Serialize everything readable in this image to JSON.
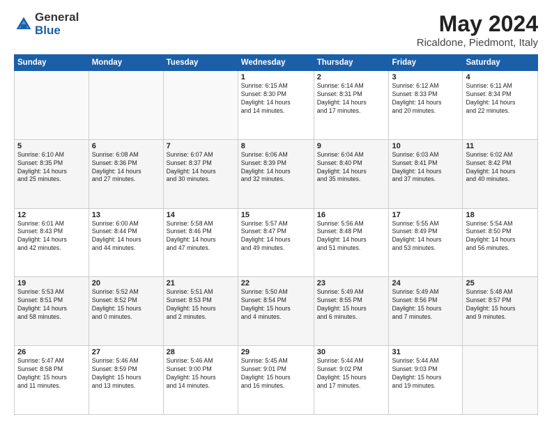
{
  "header": {
    "logo_general": "General",
    "logo_blue": "Blue",
    "title": "May 2024",
    "location": "Ricaldone, Piedmont, Italy"
  },
  "days_of_week": [
    "Sunday",
    "Monday",
    "Tuesday",
    "Wednesday",
    "Thursday",
    "Friday",
    "Saturday"
  ],
  "weeks": [
    [
      {
        "day": "",
        "content": ""
      },
      {
        "day": "",
        "content": ""
      },
      {
        "day": "",
        "content": ""
      },
      {
        "day": "1",
        "content": "Sunrise: 6:15 AM\nSunset: 8:30 PM\nDaylight: 14 hours\nand 14 minutes."
      },
      {
        "day": "2",
        "content": "Sunrise: 6:14 AM\nSunset: 8:31 PM\nDaylight: 14 hours\nand 17 minutes."
      },
      {
        "day": "3",
        "content": "Sunrise: 6:12 AM\nSunset: 8:33 PM\nDaylight: 14 hours\nand 20 minutes."
      },
      {
        "day": "4",
        "content": "Sunrise: 6:11 AM\nSunset: 8:34 PM\nDaylight: 14 hours\nand 22 minutes."
      }
    ],
    [
      {
        "day": "5",
        "content": "Sunrise: 6:10 AM\nSunset: 8:35 PM\nDaylight: 14 hours\nand 25 minutes."
      },
      {
        "day": "6",
        "content": "Sunrise: 6:08 AM\nSunset: 8:36 PM\nDaylight: 14 hours\nand 27 minutes."
      },
      {
        "day": "7",
        "content": "Sunrise: 6:07 AM\nSunset: 8:37 PM\nDaylight: 14 hours\nand 30 minutes."
      },
      {
        "day": "8",
        "content": "Sunrise: 6:06 AM\nSunset: 8:39 PM\nDaylight: 14 hours\nand 32 minutes."
      },
      {
        "day": "9",
        "content": "Sunrise: 6:04 AM\nSunset: 8:40 PM\nDaylight: 14 hours\nand 35 minutes."
      },
      {
        "day": "10",
        "content": "Sunrise: 6:03 AM\nSunset: 8:41 PM\nDaylight: 14 hours\nand 37 minutes."
      },
      {
        "day": "11",
        "content": "Sunrise: 6:02 AM\nSunset: 8:42 PM\nDaylight: 14 hours\nand 40 minutes."
      }
    ],
    [
      {
        "day": "12",
        "content": "Sunrise: 6:01 AM\nSunset: 8:43 PM\nDaylight: 14 hours\nand 42 minutes."
      },
      {
        "day": "13",
        "content": "Sunrise: 6:00 AM\nSunset: 8:44 PM\nDaylight: 14 hours\nand 44 minutes."
      },
      {
        "day": "14",
        "content": "Sunrise: 5:58 AM\nSunset: 8:46 PM\nDaylight: 14 hours\nand 47 minutes."
      },
      {
        "day": "15",
        "content": "Sunrise: 5:57 AM\nSunset: 8:47 PM\nDaylight: 14 hours\nand 49 minutes."
      },
      {
        "day": "16",
        "content": "Sunrise: 5:56 AM\nSunset: 8:48 PM\nDaylight: 14 hours\nand 51 minutes."
      },
      {
        "day": "17",
        "content": "Sunrise: 5:55 AM\nSunset: 8:49 PM\nDaylight: 14 hours\nand 53 minutes."
      },
      {
        "day": "18",
        "content": "Sunrise: 5:54 AM\nSunset: 8:50 PM\nDaylight: 14 hours\nand 56 minutes."
      }
    ],
    [
      {
        "day": "19",
        "content": "Sunrise: 5:53 AM\nSunset: 8:51 PM\nDaylight: 14 hours\nand 58 minutes."
      },
      {
        "day": "20",
        "content": "Sunrise: 5:52 AM\nSunset: 8:52 PM\nDaylight: 15 hours\nand 0 minutes."
      },
      {
        "day": "21",
        "content": "Sunrise: 5:51 AM\nSunset: 8:53 PM\nDaylight: 15 hours\nand 2 minutes."
      },
      {
        "day": "22",
        "content": "Sunrise: 5:50 AM\nSunset: 8:54 PM\nDaylight: 15 hours\nand 4 minutes."
      },
      {
        "day": "23",
        "content": "Sunrise: 5:49 AM\nSunset: 8:55 PM\nDaylight: 15 hours\nand 6 minutes."
      },
      {
        "day": "24",
        "content": "Sunrise: 5:49 AM\nSunset: 8:56 PM\nDaylight: 15 hours\nand 7 minutes."
      },
      {
        "day": "25",
        "content": "Sunrise: 5:48 AM\nSunset: 8:57 PM\nDaylight: 15 hours\nand 9 minutes."
      }
    ],
    [
      {
        "day": "26",
        "content": "Sunrise: 5:47 AM\nSunset: 8:58 PM\nDaylight: 15 hours\nand 11 minutes."
      },
      {
        "day": "27",
        "content": "Sunrise: 5:46 AM\nSunset: 8:59 PM\nDaylight: 15 hours\nand 13 minutes."
      },
      {
        "day": "28",
        "content": "Sunrise: 5:46 AM\nSunset: 9:00 PM\nDaylight: 15 hours\nand 14 minutes."
      },
      {
        "day": "29",
        "content": "Sunrise: 5:45 AM\nSunset: 9:01 PM\nDaylight: 15 hours\nand 16 minutes."
      },
      {
        "day": "30",
        "content": "Sunrise: 5:44 AM\nSunset: 9:02 PM\nDaylight: 15 hours\nand 17 minutes."
      },
      {
        "day": "31",
        "content": "Sunrise: 5:44 AM\nSunset: 9:03 PM\nDaylight: 15 hours\nand 19 minutes."
      },
      {
        "day": "",
        "content": ""
      }
    ]
  ]
}
